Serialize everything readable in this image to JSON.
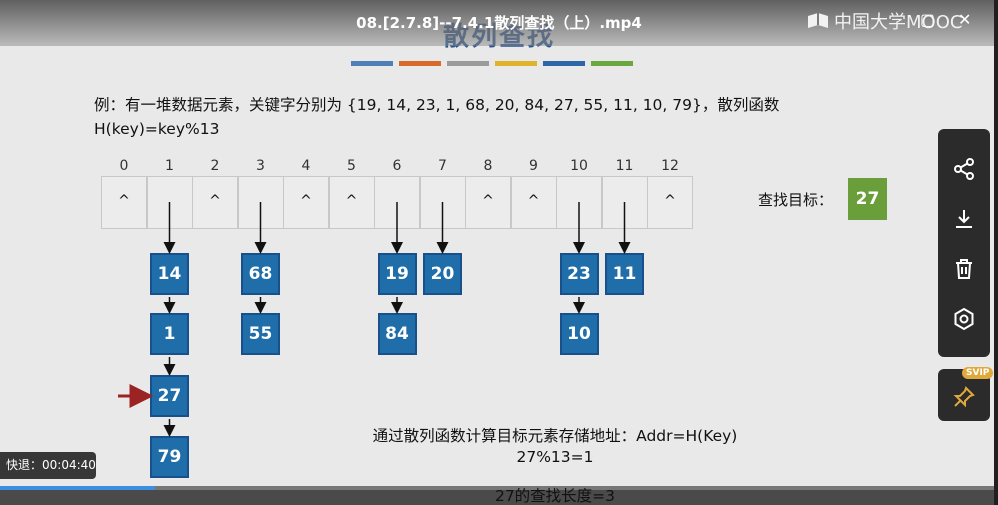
{
  "player": {
    "title": "08.[2.7.8]--7.4.1散列查找（上）.mp4",
    "logo_text": "中国大学MOOC",
    "close": "✕",
    "restore": "▢",
    "rewind_text": "快退：00:04:40",
    "progress": 0.155,
    "svip_badge": "SVIP"
  },
  "slide": {
    "title": "散列查找",
    "title_bars": [
      "#4f7fb5",
      "#d86b2b",
      "#9b9b9b",
      "#e0b42a",
      "#2f66a9",
      "#6aa83f"
    ],
    "example_line1": "例：有一堆数据元素，关键字分别为 {19, 14, 23, 1, 68, 20, 84, 27, 55, 11, 10, 79}，散列函数",
    "example_line2": "H(key)=key%13",
    "indices": [
      "0",
      "1",
      "2",
      "3",
      "4",
      "5",
      "6",
      "7",
      "8",
      "9",
      "10",
      "11",
      "12"
    ],
    "cells": [
      "^",
      "",
      "^",
      "",
      "^",
      "^",
      "",
      "",
      "^",
      "^",
      "",
      "",
      "^"
    ],
    "chains": [
      {
        "index": "1",
        "nodes": [
          "14",
          "1",
          "27",
          "79"
        ]
      },
      {
        "index": "3",
        "nodes": [
          "68",
          "55"
        ]
      },
      {
        "index": "6",
        "nodes": [
          "19",
          "84"
        ]
      },
      {
        "index": "7",
        "nodes": [
          "20"
        ]
      },
      {
        "index": "10",
        "nodes": [
          "23",
          "10"
        ]
      },
      {
        "index": "11",
        "nodes": [
          "11"
        ]
      }
    ],
    "target_label": "查找目标：",
    "target_value": "27",
    "formula_line1": "通过散列函数计算目标元素存储地址：Addr=H(Key)",
    "formula_line2": "27%13=1",
    "formula_line3": "27的查找长度=3",
    "colors": {
      "node": "#1f6da9",
      "target": "#6a9e3a",
      "pointer_arrow": "#9b2323"
    }
  },
  "side_panel": {
    "icons": [
      "share-icon",
      "download-icon",
      "delete-icon",
      "settings-icon",
      "pin-icon"
    ]
  }
}
